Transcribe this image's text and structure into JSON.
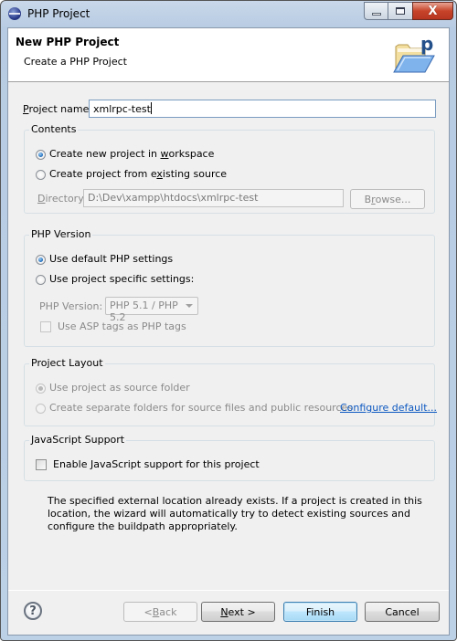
{
  "window": {
    "title": "PHP Project",
    "controls": {
      "minimize": "minimize",
      "maximize": "maximize",
      "close": "X"
    }
  },
  "header": {
    "title": "New PHP Project",
    "subtitle": "Create a PHP Project",
    "icon": "php-folder-icon"
  },
  "project_name": {
    "label_mnemonic": "P",
    "label_rest": "roject name:",
    "value": "xmlrpc-test"
  },
  "contents": {
    "title": "Contents",
    "option_new": {
      "pre": "Create new project in ",
      "mnemonic": "w",
      "post": "orkspace",
      "selected": true
    },
    "option_existing": {
      "pre": "Create project from e",
      "mnemonic": "x",
      "post": "isting source",
      "selected": false
    },
    "directory_label_mnemonic": "D",
    "directory_label_rest": "irectory:",
    "directory_value": "D:\\Dev\\xampp\\htdocs\\xmlrpc-test",
    "browse_pre": "B",
    "browse_mnemonic": "r",
    "browse_post": "owse..."
  },
  "php_version": {
    "title": "PHP Version",
    "option_default": {
      "label": "Use default PHP settings",
      "selected": true
    },
    "option_specific": {
      "label": "Use project specific settings:",
      "selected": false
    },
    "version_label": "PHP Version:",
    "version_selected": "PHP 5.1 / PHP 5.2",
    "asp_tags_label": "Use ASP tags as PHP tags",
    "asp_tags_checked": false
  },
  "project_layout": {
    "title": "Project Layout",
    "option_source": {
      "label": "Use project as source folder",
      "selected": true
    },
    "option_separate": {
      "label": "Create separate folders for source files and public resources",
      "selected": false
    },
    "configure_link": "Configure default..."
  },
  "javascript": {
    "title": "JavaScript Support",
    "enable_label": "Enable JavaScript support for this project",
    "enabled": false
  },
  "message": "The specified external location already exists. If a project is created in this location, the wizard will automatically try to detect existing sources and configure the buildpath appropriately.",
  "footer": {
    "help": "?",
    "back_pre": "< ",
    "back_mnemonic": "B",
    "back_post": "ack",
    "next_mnemonic": "N",
    "next_post": "ext >",
    "finish": "Finish",
    "cancel": "Cancel"
  },
  "colors": {
    "link": "#0b57c0",
    "close_button": "#c7442a",
    "default_button_border": "#3c7fb1"
  }
}
